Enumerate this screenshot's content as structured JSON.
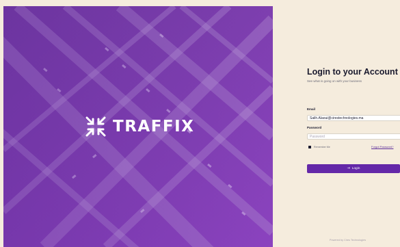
{
  "brand": {
    "name": "TRAFFIX",
    "logo_icon": "traffix-logo-icon"
  },
  "login": {
    "title": "Login to your Account",
    "subtitle": "See what is going on with your business",
    "email_label": "Email",
    "email_value": "Salih.Alaoui@cirestechnologies.ma",
    "password_label": "Password",
    "password_placeholder": "Password",
    "remember_label": "Remember Me",
    "forgot_label": "Forgot Password?",
    "login_button_label": "Login",
    "login_icon": "login-arrow-icon"
  },
  "footer": {
    "text": "Powered by Cires Technologies"
  },
  "colors": {
    "accent": "#6428a8",
    "hero_overlay": "#7a3fb0",
    "background": "#f5ecdd"
  }
}
